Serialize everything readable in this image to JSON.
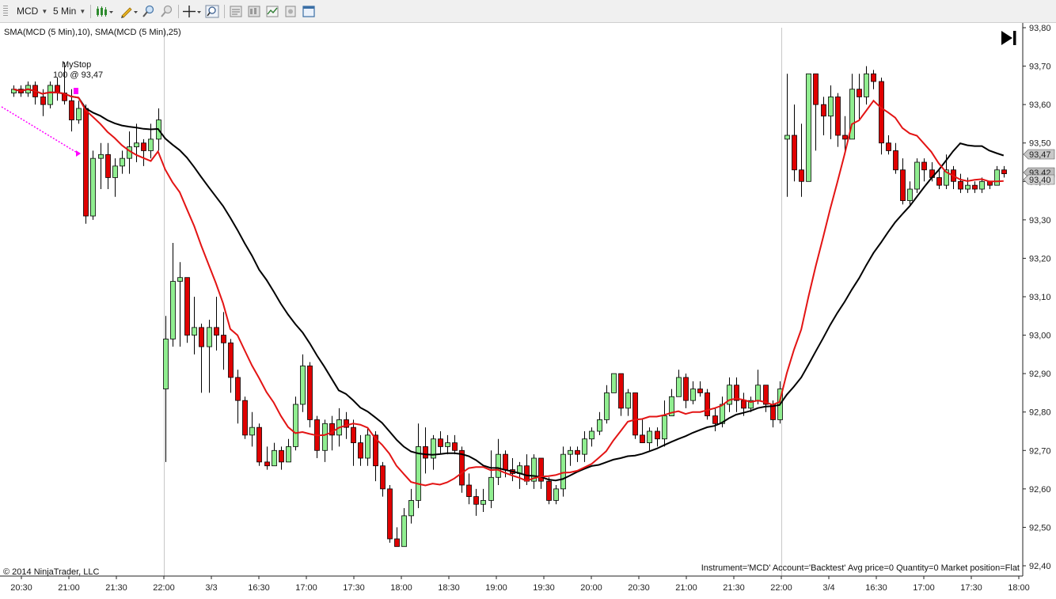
{
  "toolbar": {
    "instrument": "MCD",
    "interval": "5 Min",
    "buttons": [
      "bar-type-icon",
      "drawing-pencil-icon",
      "zoom-in-icon",
      "zoom-out-icon",
      "crosshair-icon",
      "magnifier-icon",
      "properties-icon",
      "data-box-icon",
      "indicators-icon",
      "strategies-icon",
      "window-linking-icon"
    ]
  },
  "chart": {
    "indicator_label": "SMA(MCD (5 Min),10), SMA(MCD (5 Min),25)",
    "copyright": "© 2014 NinjaTrader, LLC",
    "status": "Instrument='MCD' Account='Backtest' Avg price=0 Quantity=0 Market position=Flat",
    "order_label_line1": "MyStop",
    "order_label_line2": "100 @ 93,47",
    "price_badges": [
      "93,47",
      "93,42",
      "93,40"
    ],
    "colors": {
      "up": "#90ee90",
      "down": "#e00000",
      "sma10": "#e31414",
      "sma25": "#000000",
      "stop": "#ff00ff"
    }
  },
  "chart_data": {
    "type": "candlestick",
    "instrument": "MCD",
    "interval": "5 Min",
    "y_ticks": [
      "93,80",
      "93,70",
      "93,60",
      "93,50",
      "93,40",
      "93,30",
      "93,20",
      "93,10",
      "93,00",
      "92,90",
      "92,80",
      "92,70",
      "92,60",
      "92,50",
      "92,40"
    ],
    "ylim": [
      92.39,
      93.8
    ],
    "x_ticks": [
      "20:30",
      "21:00",
      "21:30",
      "22:00",
      "3/3",
      "16:30",
      "17:00",
      "17:30",
      "18:00",
      "18:30",
      "19:00",
      "19:30",
      "20:00",
      "20:30",
      "21:00",
      "21:30",
      "22:00",
      "3/4",
      "16:30",
      "17:00",
      "17:30",
      "18:00"
    ],
    "candles": [
      [
        93.63,
        93.64,
        93.62,
        93.65
      ],
      [
        93.64,
        93.63,
        93.62,
        93.65
      ],
      [
        93.63,
        93.65,
        93.62,
        93.66
      ],
      [
        93.65,
        93.62,
        93.6,
        93.66
      ],
      [
        93.62,
        93.6,
        93.57,
        93.64
      ],
      [
        93.6,
        93.65,
        93.59,
        93.66
      ],
      [
        93.65,
        93.63,
        93.61,
        93.67
      ],
      [
        93.63,
        93.61,
        93.6,
        93.71
      ],
      [
        93.61,
        93.56,
        93.53,
        93.64
      ],
      [
        93.56,
        93.59,
        93.55,
        93.61
      ],
      [
        93.59,
        93.31,
        93.29,
        93.6
      ],
      [
        93.31,
        93.46,
        93.3,
        93.48
      ],
      [
        93.46,
        93.47,
        93.38,
        93.5
      ],
      [
        93.47,
        93.41,
        93.38,
        93.5
      ],
      [
        93.41,
        93.44,
        93.36,
        93.46
      ],
      [
        93.44,
        93.46,
        93.42,
        93.48
      ],
      [
        93.46,
        93.49,
        93.42,
        93.53
      ],
      [
        93.49,
        93.5,
        93.45,
        93.55
      ],
      [
        93.5,
        93.48,
        93.44,
        93.51
      ],
      [
        93.48,
        93.51,
        93.46,
        93.55
      ],
      [
        93.51,
        93.56,
        93.48,
        93.59
      ],
      [
        92.86,
        92.99,
        92.67,
        93.05
      ],
      [
        92.99,
        93.14,
        92.97,
        93.24
      ],
      [
        93.14,
        93.15,
        92.97,
        93.19
      ],
      [
        93.15,
        93.0,
        92.98,
        93.12
      ],
      [
        93.0,
        93.02,
        92.95,
        93.1
      ],
      [
        93.02,
        92.97,
        92.85,
        93.03
      ],
      [
        92.97,
        93.02,
        92.85,
        93.04
      ],
      [
        93.02,
        93.0,
        92.96,
        93.1
      ],
      [
        93.0,
        92.98,
        92.91,
        93.06
      ],
      [
        92.98,
        92.89,
        92.85,
        92.99
      ],
      [
        92.89,
        92.83,
        92.77,
        92.91
      ],
      [
        92.83,
        92.74,
        92.73,
        92.84
      ],
      [
        92.74,
        92.76,
        92.71,
        92.8
      ],
      [
        92.76,
        92.67,
        92.66,
        92.77
      ],
      [
        92.67,
        92.66,
        92.65,
        92.71
      ],
      [
        92.66,
        92.7,
        92.66,
        92.72
      ],
      [
        92.7,
        92.67,
        92.65,
        92.71
      ],
      [
        92.67,
        92.71,
        92.67,
        92.73
      ],
      [
        92.71,
        92.82,
        92.7,
        92.84
      ],
      [
        92.82,
        92.92,
        92.8,
        92.95
      ],
      [
        92.92,
        92.78,
        92.76,
        92.93
      ],
      [
        92.78,
        92.7,
        92.68,
        92.79
      ],
      [
        92.7,
        92.77,
        92.67,
        92.78
      ],
      [
        92.77,
        92.74,
        92.7,
        92.79
      ],
      [
        92.74,
        92.78,
        92.71,
        92.81
      ],
      [
        92.78,
        92.76,
        92.73,
        92.8
      ],
      [
        92.76,
        92.72,
        92.66,
        92.78
      ],
      [
        92.72,
        92.68,
        92.66,
        92.74
      ],
      [
        92.68,
        92.74,
        92.66,
        92.76
      ],
      [
        92.74,
        92.66,
        92.62,
        92.75
      ],
      [
        92.66,
        92.6,
        92.58,
        92.67
      ],
      [
        92.6,
        92.47,
        92.46,
        92.61
      ],
      [
        92.47,
        92.45,
        92.45,
        92.5
      ],
      [
        92.45,
        92.53,
        92.45,
        92.55
      ],
      [
        92.53,
        92.57,
        92.51,
        92.6
      ],
      [
        92.57,
        92.71,
        92.55,
        92.77
      ],
      [
        92.71,
        92.68,
        92.64,
        92.76
      ],
      [
        92.68,
        92.73,
        92.65,
        92.74
      ],
      [
        92.73,
        92.71,
        92.69,
        92.75
      ],
      [
        92.71,
        92.72,
        92.69,
        92.74
      ],
      [
        92.72,
        92.7,
        92.69,
        92.74
      ],
      [
        92.7,
        92.61,
        92.59,
        92.71
      ],
      [
        92.61,
        92.58,
        92.56,
        92.64
      ],
      [
        92.58,
        92.56,
        92.53,
        92.6
      ],
      [
        92.56,
        92.57,
        92.54,
        92.6
      ],
      [
        92.57,
        92.63,
        92.55,
        92.7
      ],
      [
        92.63,
        92.69,
        92.61,
        92.73
      ],
      [
        92.69,
        92.65,
        92.63,
        92.7
      ],
      [
        92.65,
        92.64,
        92.62,
        92.68
      ],
      [
        92.64,
        92.66,
        92.6,
        92.67
      ],
      [
        92.66,
        92.62,
        92.61,
        92.69
      ],
      [
        92.62,
        92.68,
        92.6,
        92.69
      ],
      [
        92.68,
        92.62,
        92.6,
        92.68
      ],
      [
        92.62,
        92.57,
        92.56,
        92.63
      ],
      [
        92.57,
        92.6,
        92.56,
        92.61
      ],
      [
        92.6,
        92.69,
        92.58,
        92.71
      ],
      [
        92.69,
        92.7,
        92.66,
        92.71
      ],
      [
        92.7,
        92.69,
        92.67,
        92.71
      ],
      [
        92.69,
        92.73,
        92.67,
        92.75
      ],
      [
        92.73,
        92.75,
        92.71,
        92.76
      ],
      [
        92.75,
        92.78,
        92.74,
        92.8
      ],
      [
        92.78,
        92.85,
        92.77,
        92.87
      ],
      [
        92.85,
        92.9,
        92.85,
        92.9
      ],
      [
        92.9,
        92.81,
        92.79,
        92.9
      ],
      [
        92.81,
        92.85,
        92.79,
        92.86
      ],
      [
        92.85,
        92.74,
        92.73,
        92.85
      ],
      [
        92.74,
        92.72,
        92.72,
        92.78
      ],
      [
        92.72,
        92.75,
        92.7,
        92.76
      ],
      [
        92.75,
        92.73,
        92.71,
        92.76
      ],
      [
        92.73,
        92.79,
        92.71,
        92.83
      ],
      [
        92.79,
        92.84,
        92.8,
        92.86
      ],
      [
        92.84,
        92.89,
        92.84,
        92.91
      ],
      [
        92.89,
        92.83,
        92.81,
        92.9
      ],
      [
        92.83,
        92.86,
        92.82,
        92.88
      ],
      [
        92.86,
        92.85,
        92.84,
        92.88
      ],
      [
        92.85,
        92.79,
        92.78,
        92.86
      ],
      [
        92.79,
        92.77,
        92.75,
        92.81
      ],
      [
        92.77,
        92.82,
        92.76,
        92.84
      ],
      [
        92.82,
        92.87,
        92.8,
        92.89
      ],
      [
        92.87,
        92.83,
        92.8,
        92.89
      ],
      [
        92.83,
        92.81,
        92.79,
        92.85
      ],
      [
        92.81,
        92.83,
        92.8,
        92.84
      ],
      [
        92.83,
        92.87,
        92.82,
        92.91
      ],
      [
        92.87,
        92.82,
        92.8,
        92.87
      ],
      [
        92.82,
        92.78,
        92.76,
        92.83
      ],
      [
        92.78,
        92.86,
        92.77,
        92.88
      ],
      [
        93.51,
        93.52,
        93.36,
        93.68
      ],
      [
        93.52,
        93.43,
        93.4,
        93.6
      ],
      [
        93.43,
        93.4,
        93.36,
        93.55
      ],
      [
        93.4,
        93.68,
        93.4,
        93.68
      ],
      [
        93.68,
        93.6,
        93.48,
        93.68
      ],
      [
        93.6,
        93.57,
        93.52,
        93.62
      ],
      [
        93.57,
        93.62,
        93.51,
        93.65
      ],
      [
        93.62,
        93.52,
        93.49,
        93.63
      ],
      [
        93.52,
        93.51,
        93.48,
        93.57
      ],
      [
        93.51,
        93.64,
        93.51,
        93.68
      ],
      [
        93.64,
        93.62,
        93.56,
        93.68
      ],
      [
        93.62,
        93.68,
        93.6,
        93.7
      ],
      [
        93.68,
        93.66,
        93.64,
        93.69
      ],
      [
        93.66,
        93.5,
        93.47,
        93.67
      ],
      [
        93.5,
        93.48,
        93.47,
        93.52
      ],
      [
        93.48,
        93.43,
        93.42,
        93.5
      ],
      [
        93.43,
        93.35,
        93.34,
        93.46
      ],
      [
        93.35,
        93.38,
        93.34,
        93.4
      ],
      [
        93.38,
        93.45,
        93.37,
        93.46
      ],
      [
        93.45,
        93.43,
        93.4,
        93.46
      ],
      [
        93.43,
        93.41,
        93.4,
        93.45
      ],
      [
        93.41,
        93.39,
        93.38,
        93.43
      ],
      [
        93.39,
        93.43,
        93.38,
        93.47
      ],
      [
        93.43,
        93.4,
        93.38,
        93.44
      ],
      [
        93.4,
        93.38,
        93.37,
        93.42
      ],
      [
        93.38,
        93.39,
        93.37,
        93.41
      ],
      [
        93.39,
        93.38,
        93.37,
        93.4
      ],
      [
        93.38,
        93.4,
        93.37,
        93.41
      ],
      [
        93.4,
        93.39,
        93.38,
        93.4
      ],
      [
        93.39,
        93.43,
        93.39,
        93.44
      ],
      [
        93.43,
        93.42,
        93.41,
        93.44
      ]
    ]
  }
}
